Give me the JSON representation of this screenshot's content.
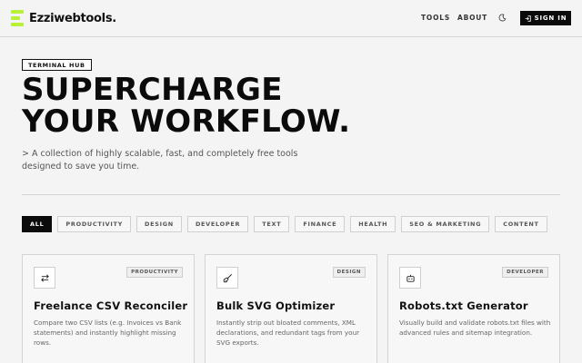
{
  "brand": {
    "name": "Ezziwebtools.",
    "accent": "#b8f03a"
  },
  "nav": {
    "tools": "TOOLS",
    "about": "ABOUT",
    "theme_icon": "moon-icon",
    "signin": "SIGN IN"
  },
  "hero": {
    "tag": "TERMINAL HUB",
    "title_line1": "SUPERCHARGE",
    "title_line2": "YOUR WORKFLOW.",
    "subtitle": "> A collection of highly scalable, fast, and completely free tools designed to save you time."
  },
  "filters": [
    "ALL",
    "PRODUCTIVITY",
    "DESIGN",
    "DEVELOPER",
    "TEXT",
    "FINANCE",
    "HEALTH",
    "SEO & MARKETING",
    "CONTENT"
  ],
  "active_filter": "ALL",
  "cards": [
    {
      "icon": "swap-arrows-icon",
      "badge": "PRODUCTIVITY",
      "title": "Freelance CSV Reconciler",
      "description": "Compare two CSV lists (e.g. Invoices vs Bank statements) and instantly highlight missing rows."
    },
    {
      "icon": "paintbrush-icon",
      "badge": "DESIGN",
      "title": "Bulk SVG Optimizer",
      "description": "Instantly strip out bloated comments, XML declarations, and redundant tags from your SVG exports."
    },
    {
      "icon": "robot-icon",
      "badge": "DEVELOPER",
      "title": "Robots.txt Generator",
      "description": "Visually build and validate robots.txt files with advanced rules and sitemap integration."
    }
  ]
}
